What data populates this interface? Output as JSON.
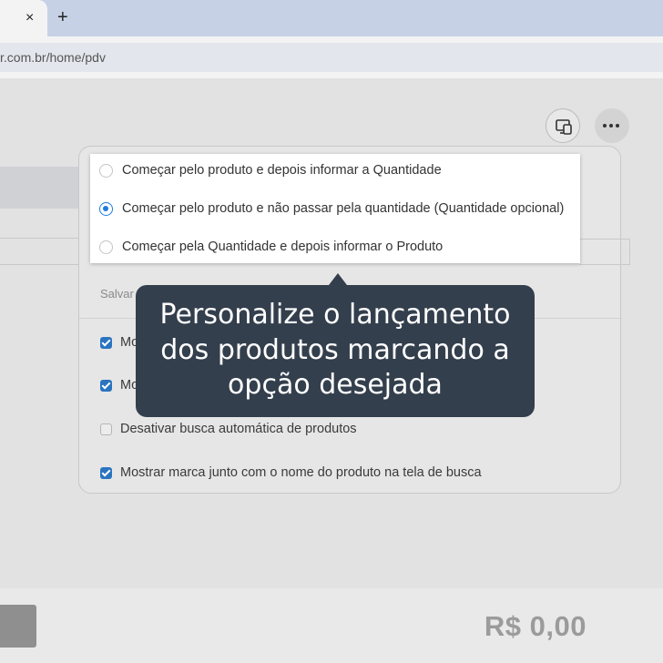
{
  "browser": {
    "close_tab_glyph": "×",
    "new_tab_glyph": "+",
    "url": "r.com.br/home/pdv"
  },
  "toolbar_icons": [
    "devices-icon",
    "more-icon"
  ],
  "panel": {
    "save_label": "Salvar",
    "options": [
      {
        "label": "Começar pelo produto e depois informar a Quantidade",
        "selected": false
      },
      {
        "label": "Começar pelo produto e não passar pela quantidade (Quantidade opcional)",
        "selected": true
      },
      {
        "label": "Começar pela Quantidade e depois informar o Produto",
        "selected": false
      }
    ],
    "checkboxes": [
      {
        "label": "Mo",
        "checked": true
      },
      {
        "label": "Mo",
        "checked": true
      },
      {
        "label": "Desativar busca automática de produtos",
        "checked": false
      },
      {
        "label": "Mostrar marca junto com o nome do produto na tela de busca",
        "checked": true
      }
    ]
  },
  "tooltip": {
    "lines": [
      "Personalize o lançamento",
      "dos produtos marcando a",
      "opção desejada"
    ]
  },
  "footer": {
    "total": "R$ 0,00"
  },
  "colors": {
    "tooltip_bg": "#343f4d",
    "accent_blue": "#2a74c0",
    "tab_strip": "#c6d1e6"
  }
}
